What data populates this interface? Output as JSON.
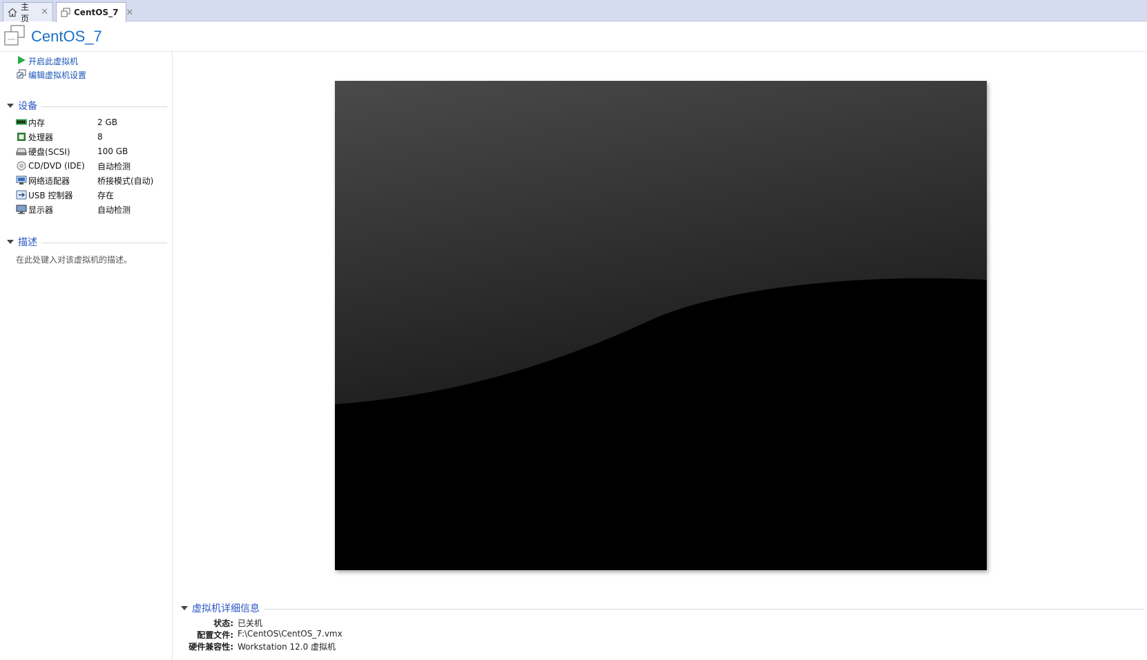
{
  "tabs": [
    {
      "label": "主页",
      "icon": "home-icon"
    },
    {
      "label": "CentOS_7",
      "icon": "vm-icon"
    }
  ],
  "vm": {
    "title": "CentOS_7"
  },
  "actions": {
    "power_on": "开启此虚拟机",
    "edit_settings": "编辑虚拟机设置"
  },
  "devices_section": {
    "title": "设备"
  },
  "devices": [
    {
      "name": "内存",
      "value": "2 GB",
      "icon": "memory-icon"
    },
    {
      "name": "处理器",
      "value": "8",
      "icon": "processor-icon"
    },
    {
      "name": "硬盘(SCSI)",
      "value": "100 GB",
      "icon": "hard-disk-icon"
    },
    {
      "name": "CD/DVD (IDE)",
      "value": "自动检测",
      "icon": "cd-dvd-icon"
    },
    {
      "name": "网络适配器",
      "value": "桥接模式(自动)",
      "icon": "network-adapter-icon"
    },
    {
      "name": "USB 控制器",
      "value": "存在",
      "icon": "usb-icon"
    },
    {
      "name": "显示器",
      "value": "自动检测",
      "icon": "display-icon"
    }
  ],
  "description_section": {
    "title": "描述",
    "placeholder": "在此处键入对该虚拟机的描述。"
  },
  "details": {
    "title": "虚拟机详细信息",
    "status_label": "状态:",
    "status_value": "已关机",
    "config_label": "配置文件:",
    "config_value": "F:\\CentOS\\CentOS_7.vmx",
    "compat_label": "硬件兼容性:",
    "compat_value": "Workstation 12.0 虚拟机"
  },
  "colors": {
    "accent": "#1a6fc7",
    "link": "#1a56b8",
    "section": "#2a55c5",
    "tabbar": "#d6dcef"
  }
}
